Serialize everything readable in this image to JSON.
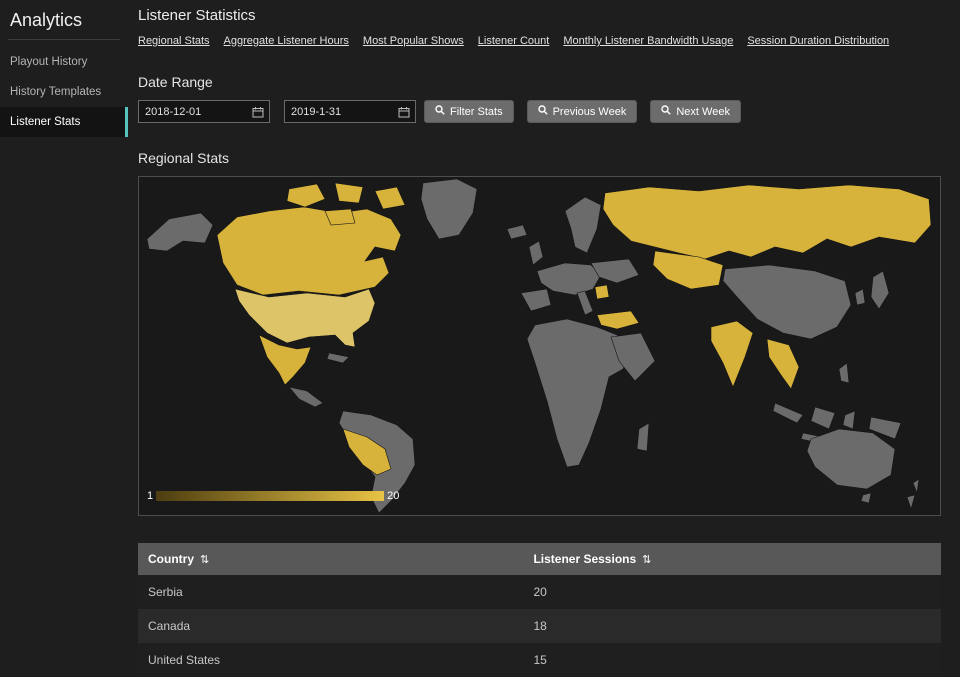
{
  "sidebar": {
    "title": "Analytics",
    "items": [
      {
        "label": "Playout History",
        "active": false
      },
      {
        "label": "History Templates",
        "active": false
      },
      {
        "label": "Listener Stats",
        "active": true
      }
    ]
  },
  "header": {
    "title": "Listener Statistics"
  },
  "nav_links": [
    "Regional Stats",
    "Aggregate Listener Hours",
    "Most Popular Shows",
    "Listener Count",
    "Monthly Listener Bandwidth Usage",
    "Session Duration Distribution"
  ],
  "date_range": {
    "label": "Date Range",
    "start_value": "2018-12-01",
    "end_value": "2019-1-31",
    "filter_button_label": "Filter Stats",
    "previous_button_label": "Previous Week",
    "next_button_label": "Next Week"
  },
  "regional_section_title": "Regional Stats",
  "map": {
    "legend_min": "1",
    "legend_max": "20",
    "highlighted_countries": [
      "Canada",
      "Mexico",
      "Peru",
      "Bolivia",
      "Serbia",
      "Turkey",
      "Russia",
      "Kazakhstan",
      "India",
      "Thailand"
    ],
    "highlight_light_countries": [
      "United States"
    ]
  },
  "table": {
    "columns": [
      "Country",
      "Listener Sessions"
    ],
    "rows": [
      {
        "country": "Serbia",
        "sessions": "20"
      },
      {
        "country": "Canada",
        "sessions": "18"
      },
      {
        "country": "United States",
        "sessions": "15"
      }
    ]
  },
  "icons": {
    "sort": "⇅"
  },
  "colors": {
    "page-bg": "#1e1e1e",
    "panel-bg": "#191919",
    "accent": "#56c5c0",
    "land": "#6b6b6b",
    "highlight": "#d7b33c",
    "highlight-light": "#ddc469",
    "legend-start": "#4d3d10",
    "legend-end": "#e8c445",
    "button-bg": "#6c6c6c",
    "table-header-bg": "#585858"
  },
  "chart_data": {
    "type": "choropleth",
    "title": "Regional Stats",
    "legend_range": [
      1,
      20
    ],
    "series": [
      {
        "name": "Serbia",
        "value": 20
      },
      {
        "name": "Canada",
        "value": 18
      },
      {
        "name": "United States",
        "value": 15
      }
    ]
  }
}
